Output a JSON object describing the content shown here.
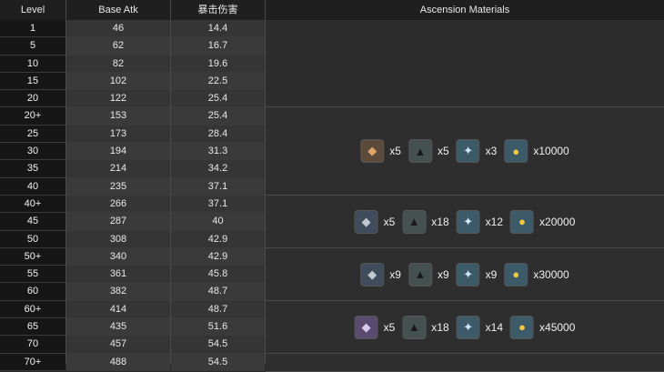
{
  "columns": {
    "level": "Level",
    "base_atk": "Base Atk",
    "crit": "暴击伤害",
    "ascension": "Ascension Materials"
  },
  "rows": [
    {
      "level": "1",
      "atk": "46",
      "crit": "14.4"
    },
    {
      "level": "5",
      "atk": "62",
      "crit": "16.7"
    },
    {
      "level": "10",
      "atk": "82",
      "crit": "19.6"
    },
    {
      "level": "15",
      "atk": "102",
      "crit": "22.5"
    },
    {
      "level": "20",
      "atk": "122",
      "crit": "25.4"
    },
    {
      "level": "20+",
      "atk": "153",
      "crit": "25.4"
    },
    {
      "level": "25",
      "atk": "173",
      "crit": "28.4"
    },
    {
      "level": "30",
      "atk": "194",
      "crit": "31.3"
    },
    {
      "level": "35",
      "atk": "214",
      "crit": "34.2"
    },
    {
      "level": "40",
      "atk": "235",
      "crit": "37.1"
    },
    {
      "level": "40+",
      "atk": "266",
      "crit": "37.1"
    },
    {
      "level": "45",
      "atk": "287",
      "crit": "40"
    },
    {
      "level": "50",
      "atk": "308",
      "crit": "42.9"
    },
    {
      "level": "50+",
      "atk": "340",
      "crit": "42.9"
    },
    {
      "level": "55",
      "atk": "361",
      "crit": "45.8"
    },
    {
      "level": "60",
      "atk": "382",
      "crit": "48.7"
    },
    {
      "level": "60+",
      "atk": "414",
      "crit": "48.7"
    },
    {
      "level": "65",
      "atk": "435",
      "crit": "51.6"
    },
    {
      "level": "70",
      "atk": "457",
      "crit": "54.5"
    },
    {
      "level": "70+",
      "atk": "488",
      "crit": "54.5"
    }
  ],
  "ascensions": [
    {
      "materials": []
    },
    {
      "materials": [
        {
          "icon": "bronze-mask-icon",
          "glyph": "◆",
          "qty": "x5"
        },
        {
          "icon": "black-feather-icon",
          "glyph": "▲",
          "qty": "x5"
        },
        {
          "icon": "blue-crystal-icon",
          "glyph": "✦",
          "qty": "x3"
        },
        {
          "icon": "mora-coin-icon",
          "glyph": "●",
          "qty": "x10000"
        }
      ]
    },
    {
      "materials": [
        {
          "icon": "grey-mask-icon",
          "glyph": "◆",
          "qty": "x5"
        },
        {
          "icon": "black-feather-icon",
          "glyph": "▲",
          "qty": "x18"
        },
        {
          "icon": "blue-crystal-icon",
          "glyph": "✦",
          "qty": "x12"
        },
        {
          "icon": "mora-coin-icon",
          "glyph": "●",
          "qty": "x20000"
        }
      ]
    },
    {
      "materials": [
        {
          "icon": "dark-mask-icon",
          "glyph": "◆",
          "qty": "x9"
        },
        {
          "icon": "black-feather-icon",
          "glyph": "▲",
          "qty": "x9"
        },
        {
          "icon": "blue-crystal-icon",
          "glyph": "✦",
          "qty": "x9"
        },
        {
          "icon": "mora-coin-icon",
          "glyph": "●",
          "qty": "x30000"
        }
      ]
    },
    {
      "materials": [
        {
          "icon": "purple-mask-icon",
          "glyph": "◆",
          "qty": "x5"
        },
        {
          "icon": "black-feather-icon",
          "glyph": "▲",
          "qty": "x18"
        },
        {
          "icon": "blue-crystal-icon",
          "glyph": "✦",
          "qty": "x14"
        },
        {
          "icon": "mora-coin-icon",
          "glyph": "●",
          "qty": "x45000"
        }
      ]
    },
    {
      "materials": []
    }
  ]
}
